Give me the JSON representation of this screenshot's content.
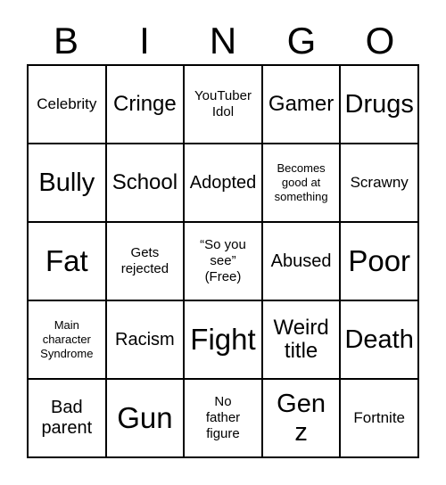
{
  "card": {
    "header_letters": [
      "B",
      "I",
      "N",
      "G",
      "O"
    ],
    "columns": 5,
    "rows": 5,
    "border_color": "#000000",
    "background_color": "#ffffff",
    "text_color": "#000000",
    "free_space_position": "center",
    "cells": [
      [
        {
          "text": "Celebrity",
          "size": "s",
          "free": false
        },
        {
          "text": "Cringe",
          "size": "l",
          "free": false
        },
        {
          "text": "YouTuber\nIdol",
          "size": "xs",
          "free": false
        },
        {
          "text": "Gamer",
          "size": "l",
          "free": false
        },
        {
          "text": "Drugs",
          "size": "xl",
          "free": false
        }
      ],
      [
        {
          "text": "Bully",
          "size": "xl",
          "free": false
        },
        {
          "text": "School",
          "size": "l",
          "free": false
        },
        {
          "text": "Adopted",
          "size": "m",
          "free": false
        },
        {
          "text": "Becomes\ngood at\nsomething",
          "size": "xxs",
          "free": false
        },
        {
          "text": "Scrawny",
          "size": "s",
          "free": false
        }
      ],
      [
        {
          "text": "Fat",
          "size": "xxl",
          "free": false
        },
        {
          "text": "Gets\nrejected",
          "size": "xs",
          "free": false
        },
        {
          "text": "“So you\nsee”\n(Free)",
          "size": "xs",
          "free": true
        },
        {
          "text": "Abused",
          "size": "m",
          "free": false
        },
        {
          "text": "Poor",
          "size": "xxl",
          "free": false
        }
      ],
      [
        {
          "text": "Main\ncharacter\nSyndrome",
          "size": "xxs",
          "free": false
        },
        {
          "text": "Racism",
          "size": "m",
          "free": false
        },
        {
          "text": "Fight",
          "size": "xxl",
          "free": false
        },
        {
          "text": "Weird\ntitle",
          "size": "l",
          "free": false
        },
        {
          "text": "Death",
          "size": "xl",
          "free": false
        }
      ],
      [
        {
          "text": "Bad\nparent",
          "size": "m",
          "free": false
        },
        {
          "text": "Gun",
          "size": "xxl",
          "free": false
        },
        {
          "text": "No\nfather\nfigure",
          "size": "xs",
          "free": false
        },
        {
          "text": "Gen\nz",
          "size": "xl",
          "free": false
        },
        {
          "text": "Fortnite",
          "size": "s",
          "free": false
        }
      ]
    ]
  }
}
